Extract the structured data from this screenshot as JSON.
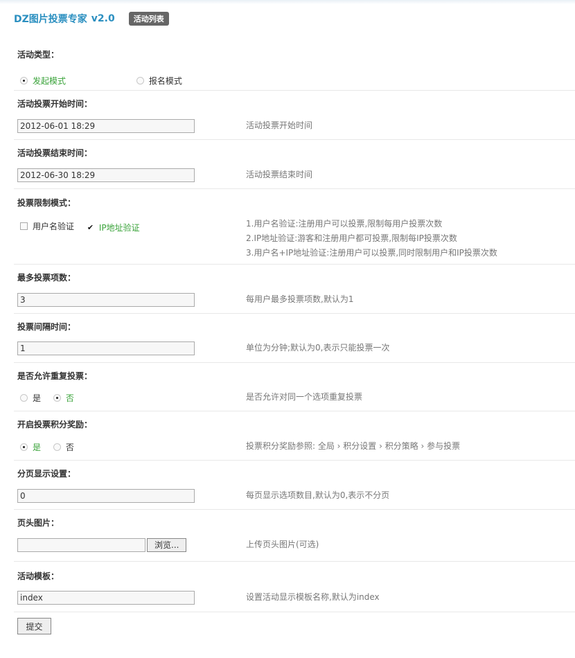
{
  "header": {
    "title": "DZ图片投票专家",
    "version": "v2.0",
    "list_button": "活动列表"
  },
  "activity_type": {
    "label": "活动类型：",
    "options": [
      "发起模式",
      "报名模式"
    ],
    "selected": 0
  },
  "start_time": {
    "label": "活动投票开始时间：",
    "value": "2012-06-01 18:29",
    "hint": "活动投票开始时间"
  },
  "end_time": {
    "label": "活动投票结束时间：",
    "value": "2012-06-30 18:29",
    "hint": "活动投票结束时间"
  },
  "limit_mode": {
    "label": "投票限制模式：",
    "options": [
      "用户名验证",
      "IP地址验证"
    ],
    "checked": [
      false,
      true
    ],
    "hints": [
      "1.用户名验证:注册用户可以投票,限制每用户投票次数",
      "2.IP地址验证:游客和注册用户都可投票,限制每IP投票次数",
      "3.用户名+IP地址验证:注册用户可以投票,同时限制用户和IP投票次数"
    ]
  },
  "max_items": {
    "label": "最多投票项数：",
    "value": "3",
    "hint": "每用户最多投票项数,默认为1"
  },
  "interval": {
    "label": "投票间隔时间：",
    "value": "1",
    "hint": "单位为分钟;默认为0,表示只能投票一次"
  },
  "repeat_vote": {
    "label": "是否允许重复投票：",
    "options": [
      "是",
      "否"
    ],
    "selected": 1,
    "hint": "是否允许对同一个选项重复投票"
  },
  "credit_reward": {
    "label": "开启投票积分奖励：",
    "options": [
      "是",
      "否"
    ],
    "selected": 0,
    "hint": "投票积分奖励参照: 全局 › 积分设置 › 积分策略 › 参与投票"
  },
  "paging": {
    "label": "分页显示设置：",
    "value": "0",
    "hint": "每页显示选项数目,默认为0,表示不分页"
  },
  "header_image": {
    "label": "页头图片：",
    "browse_label": "浏览...",
    "hint": "上传页头图片(可选)"
  },
  "template": {
    "label": "活动模板：",
    "value": "index",
    "hint": "设置活动显示模板名称,默认为index"
  },
  "submit_label": "提交"
}
